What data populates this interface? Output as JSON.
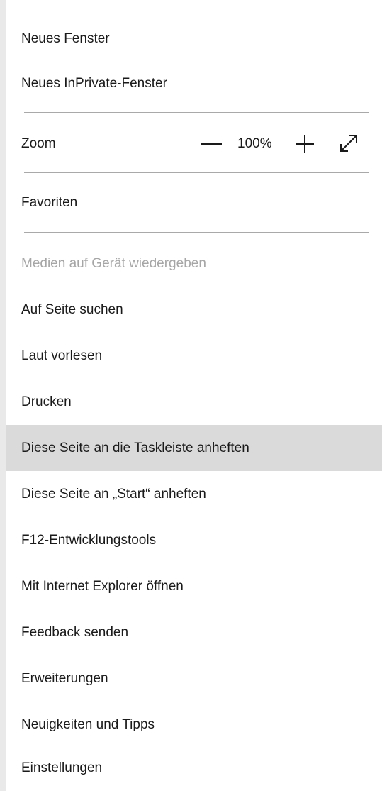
{
  "menu": {
    "new_window": "Neues Fenster",
    "new_inprivate": "Neues InPrivate-Fenster",
    "zoom": {
      "label": "Zoom",
      "value": "100%",
      "zoom_out_icon": "minus-icon",
      "zoom_in_icon": "plus-icon",
      "fullscreen_icon": "expand-diagonal-icon"
    },
    "favorites": "Favoriten",
    "cast_media": "Medien auf Gerät wiedergeben",
    "find_on_page": "Auf Seite suchen",
    "read_aloud": "Laut vorlesen",
    "print": "Drucken",
    "pin_taskbar": "Diese Seite an die Taskleiste anheften",
    "pin_start": "Diese Seite an „Start“ anheften",
    "devtools": "F12-Entwicklungstools",
    "open_ie": "Mit Internet Explorer öffnen",
    "feedback": "Feedback senden",
    "extensions": "Erweiterungen",
    "whats_new": "Neuigkeiten und Tipps",
    "settings": "Einstellungen"
  },
  "colors": {
    "accent": "#0078d7",
    "hover_bg": "#dadada",
    "disabled_text": "#a6a6a6",
    "separator": "#a9a9a9"
  }
}
